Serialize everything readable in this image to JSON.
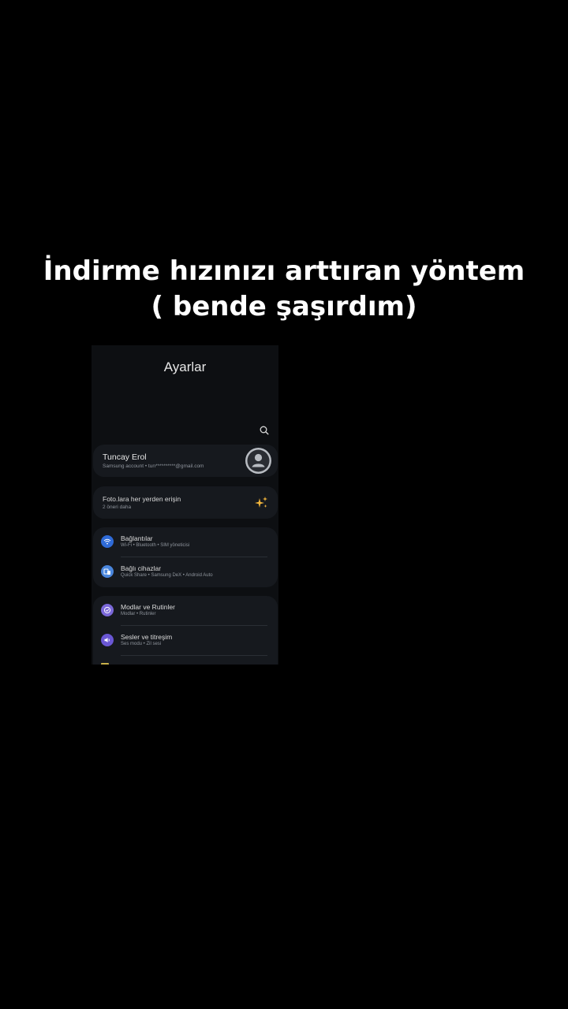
{
  "caption": {
    "line1": "İndirme hızınızı arttıran yöntem",
    "line2": "( bende şaşırdım)"
  },
  "screen": {
    "title": "Ayarlar",
    "search_icon": "search-icon",
    "profile": {
      "name": "Tuncay Erol",
      "subtitle": "Samsung account  •  tun**********@gmail.com",
      "avatar_icon": "person-icon"
    },
    "promo": {
      "title": "Foto.lara her yerden erişin",
      "subtitle": "2 öneri daha",
      "icon": "sparkle-icon",
      "icon_color": "#f0b43c"
    },
    "group1": [
      {
        "title": "Bağlantılar",
        "subtitle": "Wi-Fi  •  Bluetooth  •  SIM yöneticisi",
        "icon": "wifi-icon",
        "color": "#2f6bd8"
      },
      {
        "title": "Bağlı cihazlar",
        "subtitle": "Quick Share  •  Samsung DeX  •  Android Auto",
        "icon": "devices-icon",
        "color": "#4a86dd"
      }
    ],
    "group2": [
      {
        "title": "Modlar ve Rutinler",
        "subtitle": "Modlar  •  Rutinler",
        "icon": "modes-icon",
        "color": "#7b68d9"
      },
      {
        "title": "Sesler ve titreşim",
        "subtitle": "Ses modu  •  Zil sesi",
        "icon": "sound-icon",
        "color": "#6a57d4"
      }
    ]
  }
}
